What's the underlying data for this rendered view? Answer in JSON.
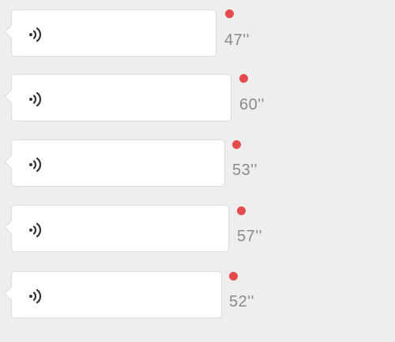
{
  "messages": [
    {
      "duration": "47''",
      "unread": true
    },
    {
      "duration": "60''",
      "unread": true
    },
    {
      "duration": "53''",
      "unread": true
    },
    {
      "duration": "57''",
      "unread": true
    },
    {
      "duration": "52''",
      "unread": true
    }
  ],
  "colors": {
    "background": "#efeeef",
    "bubble": "#ffffff",
    "unread_dot": "#e54b4b",
    "duration_text": "#8a8a8a",
    "voice_icon": "#333333"
  },
  "icons": {
    "voice": "voice-wave-icon",
    "unread": "unread-dot"
  }
}
